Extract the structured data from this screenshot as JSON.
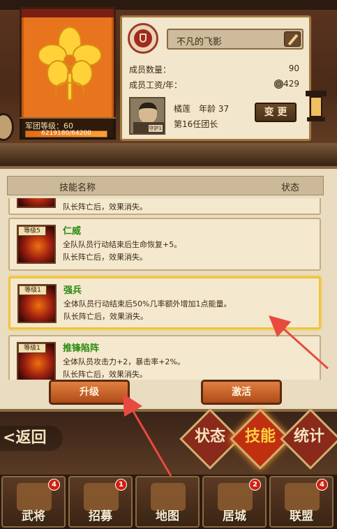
{
  "guild": {
    "level_label": "军团等级：60",
    "exp_text": "6219180/64200",
    "exp_fraction": 1.0,
    "name": "不凡的飞影",
    "members_label": "成员数量：",
    "members_value": "90",
    "salary_label": "成员工资/年：",
    "salary_value": "429",
    "leader_name": "橘莲",
    "leader_age": "年龄 37",
    "leader_title": "第16任团长",
    "leader_tag": "守护1",
    "change_button": "变 更"
  },
  "skills": {
    "header_name": "技能名称",
    "header_status": "状态",
    "partial_desc": "队长阵亡后，效果消失。",
    "items": [
      {
        "level": "等级5",
        "name": "仁威",
        "desc1": "全队队员行动结束后生命恢复+5。",
        "desc2": "队长阵亡后，效果消失。",
        "selected": false
      },
      {
        "level": "等级1",
        "name": "强兵",
        "desc1": "全体队员行动结束后50%几率额外增加1点能量。",
        "desc2": "队长阵亡后，效果消失。",
        "selected": true
      },
      {
        "level": "等级1",
        "name": "推锋陷阵",
        "desc1": "全体队员攻击力+2，暴击率+2%。",
        "desc2": "队长阵亡后，效果消失。",
        "selected": false
      }
    ],
    "upgrade_button": "升级",
    "activate_button": "激活"
  },
  "tabs": {
    "back_label": "返回",
    "status_label": "状态",
    "skills_label": "技能",
    "stats_label": "统计",
    "active": "skills"
  },
  "nav": [
    {
      "label": "武将",
      "badge": "4",
      "icon": "samurai-helmet-icon"
    },
    {
      "label": "招募",
      "badge": "1",
      "icon": "recruit-gate-icon"
    },
    {
      "label": "地图",
      "badge": "",
      "icon": "map-scroll-icon"
    },
    {
      "label": "居城",
      "badge": "2",
      "icon": "castle-icon"
    },
    {
      "label": "联盟",
      "badge": "4",
      "icon": "alliance-flag-icon"
    }
  ],
  "colors": {
    "banner": "#e8751e",
    "selected_border": "#f0c43a",
    "skill_name": "#2a8a10",
    "annotation_arrow": "#e84a40"
  }
}
